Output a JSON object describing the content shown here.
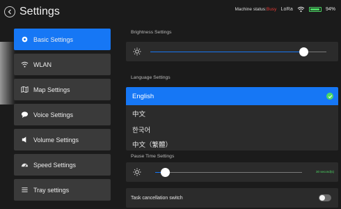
{
  "header": {
    "title": "Settings",
    "back_icon": "back-arrow-icon",
    "machine_status_label": "Machine status:",
    "machine_status_value": "Busy",
    "lora_label": "LoRa",
    "battery_percent": "94%",
    "battery_level": 0.94,
    "colors": {
      "busy": "#e53935",
      "battery": "#4cd964"
    }
  },
  "sidebar": {
    "items": [
      {
        "label": "Basic Settings",
        "icon": "gear-icon",
        "active": true
      },
      {
        "label": "WLAN",
        "icon": "wifi-icon"
      },
      {
        "label": "Map Settings",
        "icon": "map-icon"
      },
      {
        "label": "Voice Settings",
        "icon": "chat-bubble-icon"
      },
      {
        "label": "Volume Settings",
        "icon": "speaker-icon"
      },
      {
        "label": "Speed Settings",
        "icon": "speedometer-icon"
      },
      {
        "label": "Tray settings",
        "icon": "tray-icon"
      }
    ],
    "accent": "#1677f5"
  },
  "brightness": {
    "label": "Brightness Settings",
    "icon": "sun-icon",
    "level": 0.87
  },
  "language": {
    "label": "Language Settings",
    "options": [
      "English",
      "中文",
      "한국어",
      "中文（繁體）"
    ],
    "selected": "English"
  },
  "pause_time": {
    "label": "Pause Time Settings",
    "icon": "sun-icon",
    "value_text": "30 second(s)",
    "level": 0.07
  },
  "task_cancel": {
    "label": "Task cancellation switch",
    "on": false
  }
}
